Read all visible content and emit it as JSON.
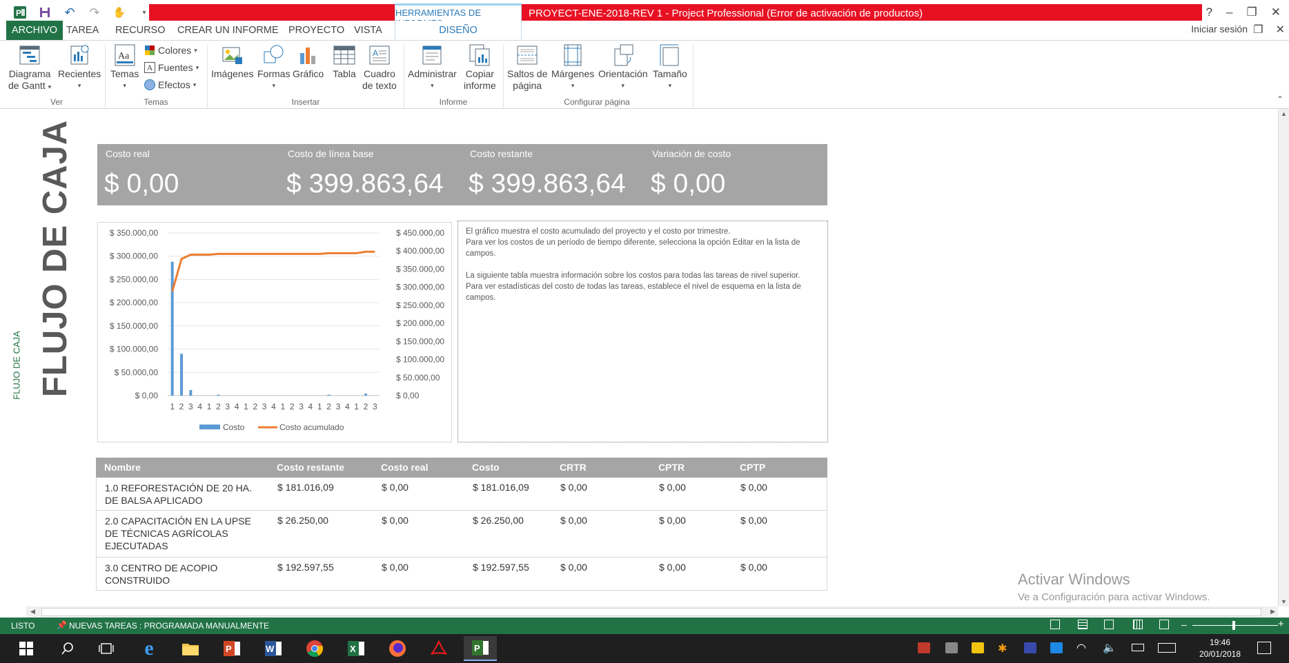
{
  "titlebar": {
    "context_tab": "HERRAMIENTAS DE INFORMES",
    "window_title": "PROYECT-ENE-2018-REV 1 -  Project Professional (Error de activación de productos)",
    "help": "?",
    "minimize": "–",
    "restore": "❐",
    "close": "✕"
  },
  "tabs": [
    "ARCHIVO",
    "TAREA",
    "RECURSO",
    "CREAR UN INFORME",
    "PROYECTO",
    "VISTA",
    "DISEÑO"
  ],
  "signin": "Iniciar sesión",
  "ribbon": {
    "ver": {
      "gantt_l1": "Diagrama",
      "gantt_l2": "de Gantt",
      "recientes": "Recientes",
      "group": "Ver"
    },
    "temas": {
      "temas": "Temas",
      "colores": "Colores",
      "fuentes": "Fuentes",
      "efectos": "Efectos",
      "group": "Temas"
    },
    "insertar": {
      "imagenes": "Imágenes",
      "formas": "Formas",
      "grafico": "Gráfico",
      "tabla": "Tabla",
      "cuadro_l1": "Cuadro",
      "cuadro_l2": "de texto",
      "group": "Insertar"
    },
    "informe": {
      "administrar": "Administrar",
      "copiar_l1": "Copiar",
      "copiar_l2": "informe",
      "group": "Informe"
    },
    "pagina": {
      "saltos_l1": "Saltos de",
      "saltos_l2": "página",
      "margenes": "Márgenes",
      "orientacion": "Orientación",
      "tamano": "Tamaño",
      "group": "Configurar página"
    }
  },
  "report": {
    "side_label": "FLUJO DE CAJA",
    "title": "FLUJO DE CAJA",
    "kpis": [
      {
        "label": "Costo real",
        "value": "$ 0,00"
      },
      {
        "label": "Costo de línea base",
        "value": "$ 399.863,64"
      },
      {
        "label": "Costo restante",
        "value": "$ 399.863,64"
      },
      {
        "label": "Variación de costo",
        "value": "$ 0,00"
      }
    ],
    "note": {
      "p1": "El gráfico muestra el costo acumulado del proyecto y el costo por trimestre.",
      "p2": "Para ver los costos de un período de tiempo diferente, selecciona la opción Editar en la lista de campos.",
      "p3": "La siguiente tabla muestra información sobre los costos para todas las tareas de nivel superior.",
      "p4": "Para ver estadísticas del costo de todas las tareas, establece el nivel de esquema en la lista de campos."
    },
    "table": {
      "headers": [
        "Nombre",
        "Costo restante",
        "Costo real",
        "Costo",
        "CRTR",
        "CPTR",
        "CPTP"
      ],
      "rows": [
        {
          "name": "1.0 REFORESTACIÓN DE 20 HA. DE BALSA APLICADO",
          "restante": "$ 181.016,09",
          "real": "$ 0,00",
          "costo": "$ 181.016,09",
          "crtr": "$ 0,00",
          "cptr": "$ 0,00",
          "cptp": "$ 0,00"
        },
        {
          "name": "2.0 CAPACITACIÓN EN LA UPSE DE TÉCNICAS AGRÍCOLAS EJECUTADAS",
          "restante": "$ 26.250,00",
          "real": "$ 0,00",
          "costo": "$ 26.250,00",
          "crtr": "$ 0,00",
          "cptr": "$ 0,00",
          "cptp": "$ 0,00"
        },
        {
          "name": "3.0 CENTRO DE ACOPIO CONSTRUIDO",
          "restante": "$ 192.597,55",
          "real": "$ 0,00",
          "costo": "$ 192.597,55",
          "crtr": "$ 0,00",
          "cptr": "$ 0,00",
          "cptp": "$ 0,00"
        }
      ]
    }
  },
  "chart_data": {
    "type": "bar",
    "categories": [
      "1",
      "2",
      "3",
      "4",
      "1",
      "2",
      "3",
      "4",
      "1",
      "2",
      "3",
      "4",
      "1",
      "2",
      "3",
      "4",
      "1",
      "2",
      "3",
      "4",
      "1",
      "2",
      "3"
    ],
    "series": [
      {
        "name": "Costo",
        "type": "bar",
        "axis": "left",
        "color": "#5b9bd5",
        "values": [
          288000,
          90000,
          12000,
          0,
          0,
          2000,
          0,
          0,
          0,
          0,
          0,
          0,
          0,
          0,
          0,
          0,
          0,
          2000,
          0,
          0,
          0,
          4000,
          0
        ]
      },
      {
        "name": "Costo acumulado",
        "type": "line",
        "axis": "right",
        "color": "#ed7d31",
        "values": [
          288000,
          378000,
          390000,
          390000,
          390000,
          392000,
          392000,
          392000,
          392000,
          392000,
          392000,
          392000,
          392000,
          392000,
          392000,
          392000,
          392000,
          394000,
          394000,
          394000,
          394000,
          398000,
          398000
        ]
      }
    ],
    "left_ticks": [
      "$ 350.000,00",
      "$ 300.000,00",
      "$ 250.000,00",
      "$ 200.000,00",
      "$ 150.000,00",
      "$ 100.000,00",
      "$ 50.000,00",
      "$ 0,00"
    ],
    "right_ticks": [
      "$ 450.000,00",
      "$ 400.000,00",
      "$ 350.000,00",
      "$ 300.000,00",
      "$ 250.000,00",
      "$ 200.000,00",
      "$ 150.000,00",
      "$ 100.000,00",
      "$ 50.000,00",
      "$ 0,00"
    ],
    "ylim_left": [
      0,
      350000
    ],
    "ylim_right": [
      0,
      450000
    ],
    "legend": "bottom"
  },
  "statusbar": {
    "ready": "LISTO",
    "new_tasks": "NUEVAS TAREAS : PROGRAMADA MANUALMENTE",
    "minus": "–",
    "plus": "+"
  },
  "watermark": {
    "line1": "Activar Windows",
    "line2": "Ve a Configuración para activar Windows."
  },
  "taskbar": {
    "time": "19:46",
    "date": "20/01/2018"
  },
  "colors": {
    "accent": "#217346",
    "red": "#e81123",
    "gray": "#a5a5a5",
    "context_blue": "#2b7bb9"
  }
}
